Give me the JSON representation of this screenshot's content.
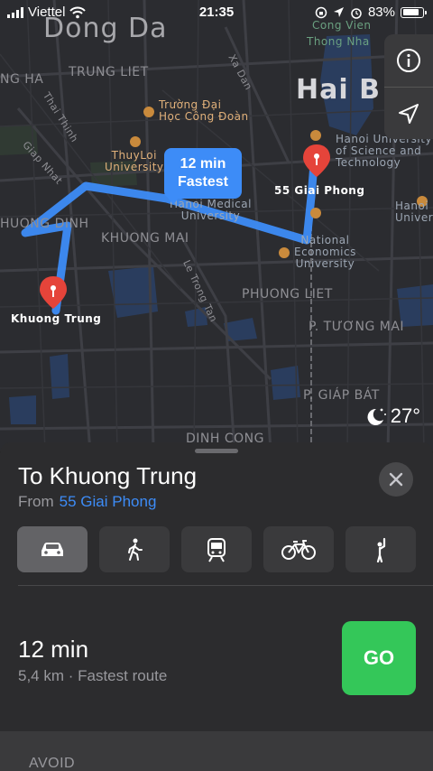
{
  "status_bar": {
    "carrier": "Viettel",
    "time": "21:35",
    "battery": "83%",
    "battery_level": 0.83
  },
  "map": {
    "labels": {
      "dong_da": "Dong Da",
      "hai_ba": "Hai B",
      "ng_ha": "NG HA",
      "trung_liet": "TRUNG LIET",
      "thai_thinh": "Thai Thinh",
      "xa_dan": "Xa Dan",
      "cong_vien": "Cong Vien",
      "thong_nhat": "Thong Nha",
      "truong_dai_1": "Trường Đại",
      "truong_dai_2": "Học Công Đoàn",
      "thuyloi_1": "ThuyLoi",
      "thuyloi_2": "University",
      "giap_nhat": "Giap Nhat",
      "khuong_dinh": "HUONG DINH",
      "khuong_mai": "KHUONG MAI",
      "hanoi_medical_1": "Hanoi Medical",
      "hanoi_medical_2": "University",
      "le_trong_tan": "Le Trong Tan",
      "hanoi_sci_1": "Hanoi University",
      "hanoi_sci_2": "of Science and",
      "hanoi_sci_3": "Technology",
      "hanoi_right_1": "Hanoi U",
      "hanoi_right_2": "Univer",
      "neu_1": "National",
      "neu_2": "Economics",
      "neu_3": "University",
      "phuong_liet": "PHUONG LIET",
      "tuong_mai": "P. TƯƠNG MAI",
      "giap_bat": "P. GIÁP BÁT",
      "dinh_cong": "DINH CONG"
    },
    "pins": {
      "destination": "Khuong Trung",
      "origin": "55 Giai Phong"
    },
    "callout": {
      "time": "12 min",
      "label": "Fastest"
    },
    "weather": {
      "temp": "27°",
      "icon": "moon-stars-icon"
    },
    "buttons": [
      "info-icon",
      "location-arrow-icon"
    ]
  },
  "sheet": {
    "title": "To Khuong Trung",
    "from_prefix": "From",
    "from_place": "55 Giai Phong",
    "modes": [
      {
        "name": "drive",
        "icon": "car-icon",
        "active": true
      },
      {
        "name": "walk",
        "icon": "walking-icon",
        "active": false
      },
      {
        "name": "transit",
        "icon": "train-icon",
        "active": false
      },
      {
        "name": "cycle",
        "icon": "bicycle-icon",
        "active": false
      },
      {
        "name": "ride",
        "icon": "hailing-person-icon",
        "active": false
      }
    ],
    "route": {
      "time": "12 min",
      "detail": "5,4 km · Fastest route",
      "go_label": "GO"
    },
    "avoid_label": "AVOID"
  },
  "colors": {
    "accent_blue": "#3d8cf7",
    "go_green": "#34c759",
    "pin_red": "#e5443a",
    "route_blue": "#3d8cf7"
  }
}
